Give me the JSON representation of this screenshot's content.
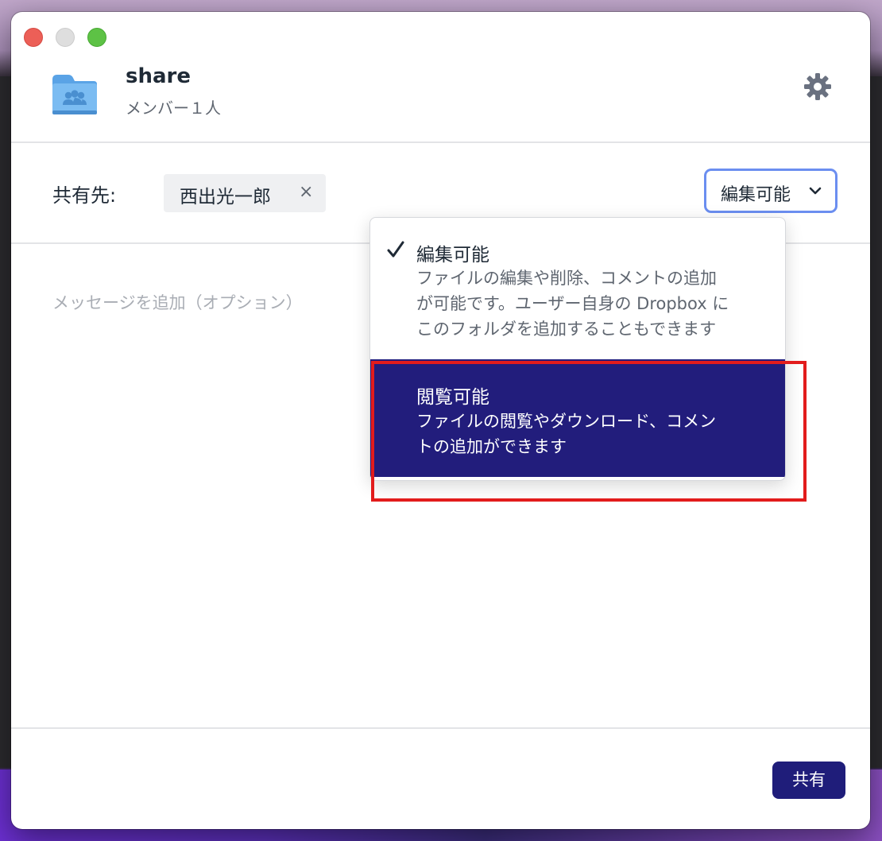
{
  "window": {
    "folder_name": "share",
    "member_count_text": "メンバー１人"
  },
  "share_row": {
    "label": "共有先:",
    "recipient": {
      "name": "西出光一郎",
      "remove_glyph": "×"
    },
    "permission_select": {
      "value": "編集可能",
      "chevron_icon": "chevron-down-icon"
    }
  },
  "message": {
    "placeholder": "メッセージを追加（オプション）"
  },
  "permission_menu": {
    "items": [
      {
        "title": "編集可能",
        "description_lines": [
          "ファイルの編集や削除、コメントの追加",
          "が可能です。ユーザー自身の Dropbox に",
          "このフォルダを追加することもできます"
        ],
        "checked": true,
        "highlighted": false
      },
      {
        "title": "閲覧可能",
        "description_lines": [
          "ファイルの閲覧やダウンロード、コメン",
          "トの追加ができます"
        ],
        "checked": false,
        "highlighted": true
      }
    ]
  },
  "footer": {
    "share_button_label": "共有"
  },
  "icons": {
    "folder": "shared-folder-icon",
    "settings": "gear-icon",
    "check": "checkmark-icon"
  },
  "colors": {
    "accent_navy": "#221d7c",
    "focus_ring": "#6b8ef0",
    "annotation_red": "#e21c1c"
  }
}
